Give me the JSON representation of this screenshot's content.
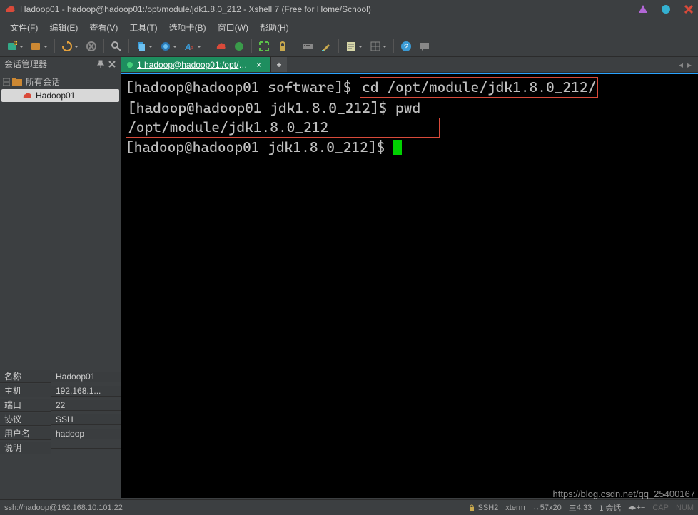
{
  "title": "Hadoop01 - hadoop@hadoop01:/opt/module/jdk1.8.0_212 - Xshell 7 (Free for Home/School)",
  "menu": {
    "file": "文件(F)",
    "edit": "编辑(E)",
    "view": "查看(V)",
    "tools": "工具(T)",
    "tab": "选项卡(B)",
    "window": "窗口(W)",
    "help": "帮助(H)"
  },
  "session_panel": {
    "title": "会话管理器",
    "root": "所有会话",
    "nodes": [
      {
        "label": "Hadoop01"
      }
    ]
  },
  "properties": [
    {
      "key": "名称",
      "value": "Hadoop01"
    },
    {
      "key": "主机",
      "value": "192.168.1..."
    },
    {
      "key": "端口",
      "value": "22"
    },
    {
      "key": "协议",
      "value": "SSH"
    },
    {
      "key": "用户名",
      "value": "hadoop"
    },
    {
      "key": "说明",
      "value": ""
    }
  ],
  "tabs": [
    {
      "label": "1 hadoop@hadoop01:/opt/m..."
    }
  ],
  "terminal": {
    "l1_prompt": "[hadoop@hadoop01 software]$ ",
    "l1_cmd": "cd /opt/module/jdk1.8.0_212/",
    "l2_prompt": "[hadoop@hadoop01 jdk1.8.0_212]$ ",
    "l2_cmd": "pwd",
    "l3_out": "/opt/module/jdk1.8.0_212",
    "l4_prompt": "[hadoop@hadoop01 jdk1.8.0_212]$ "
  },
  "status": {
    "left": "ssh://hadoop@192.168.10.101:22",
    "ssh": "SSH2",
    "term": "xterm",
    "size": "57x20",
    "uptime": "4,33",
    "sessions_label": "1 会话",
    "cap": "CAP",
    "num": "NUM",
    "nav1": "◂",
    "nav2": "▸",
    "size_icon": "�काट"
  },
  "watermark": "https://blog.csdn.net/qq_25400167"
}
